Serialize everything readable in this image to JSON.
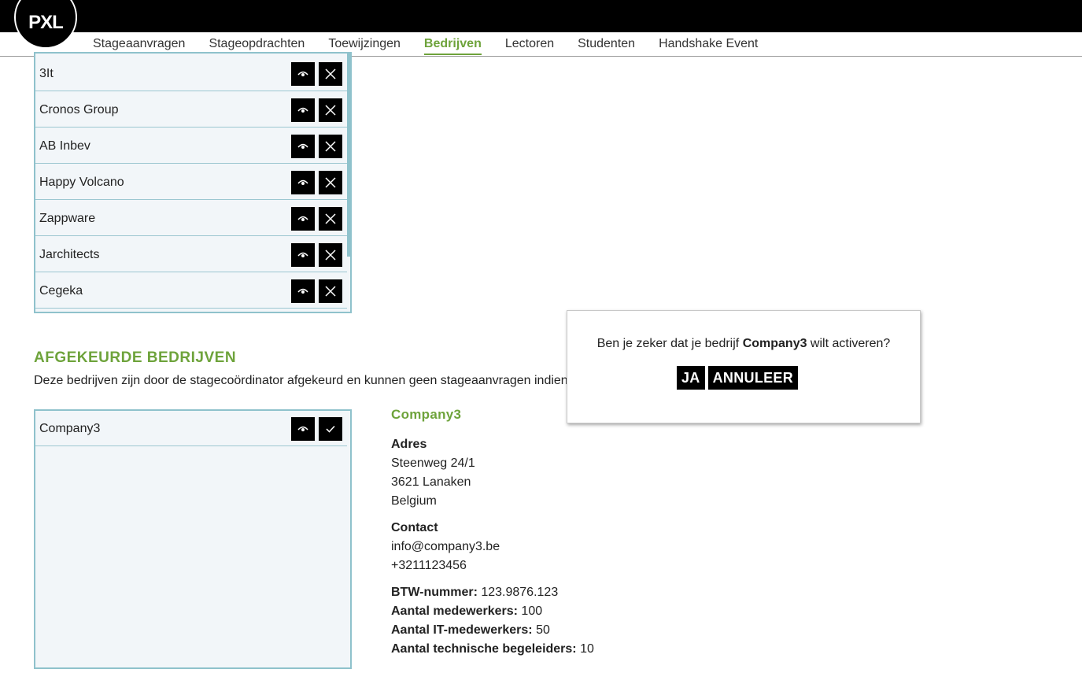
{
  "brand": {
    "logo_text": "PXL"
  },
  "nav": {
    "items": [
      "Stageaanvragen",
      "Stageopdrachten",
      "Toewijzingen",
      "Bedrijven",
      "Lectoren",
      "Studenten",
      "Handshake Event"
    ],
    "active": "Bedrijven"
  },
  "approved_list": {
    "companies": [
      "3It",
      "Cronos Group",
      "AB Inbev",
      "Happy Volcano",
      "Zappware",
      "Jarchitects",
      "Cegeka"
    ]
  },
  "rejected_section": {
    "title": "AFGEKEURDE BEDRIJVEN",
    "description": "Deze bedrijven zijn door de stagecoördinator afgekeurd en kunnen geen stageaanvragen indiene",
    "companies": [
      "Company3"
    ]
  },
  "details": {
    "company_name": "Company3",
    "address_label": "Adres",
    "address_line1": "Steenweg 24/1",
    "address_line2": "3621 Lanaken",
    "address_line3": "Belgium",
    "contact_label": "Contact",
    "email": "info@company3.be",
    "phone": "+3211123456",
    "btw_label": "BTW-nummer:",
    "btw_value": "123.9876.123",
    "employees_label": "Aantal medewerkers:",
    "employees_value": "100",
    "it_employees_label": "Aantal IT-medewerkers:",
    "it_employees_value": "50",
    "tech_mentors_label": "Aantal technische begeleiders:",
    "tech_mentors_value": "10"
  },
  "modal": {
    "msg_prefix": "Ben je zeker dat je bedrijf ",
    "msg_company": "Company3",
    "msg_suffix": " wilt activeren?",
    "yes_label": "JA",
    "cancel_label": "ANNULEER"
  },
  "icons": {
    "view": "eye-icon",
    "remove": "close-icon",
    "activate": "check-icon"
  },
  "colors": {
    "accent": "#6ea33b",
    "list_border": "#8fc2cc",
    "list_bg": "#f2f6f9"
  }
}
